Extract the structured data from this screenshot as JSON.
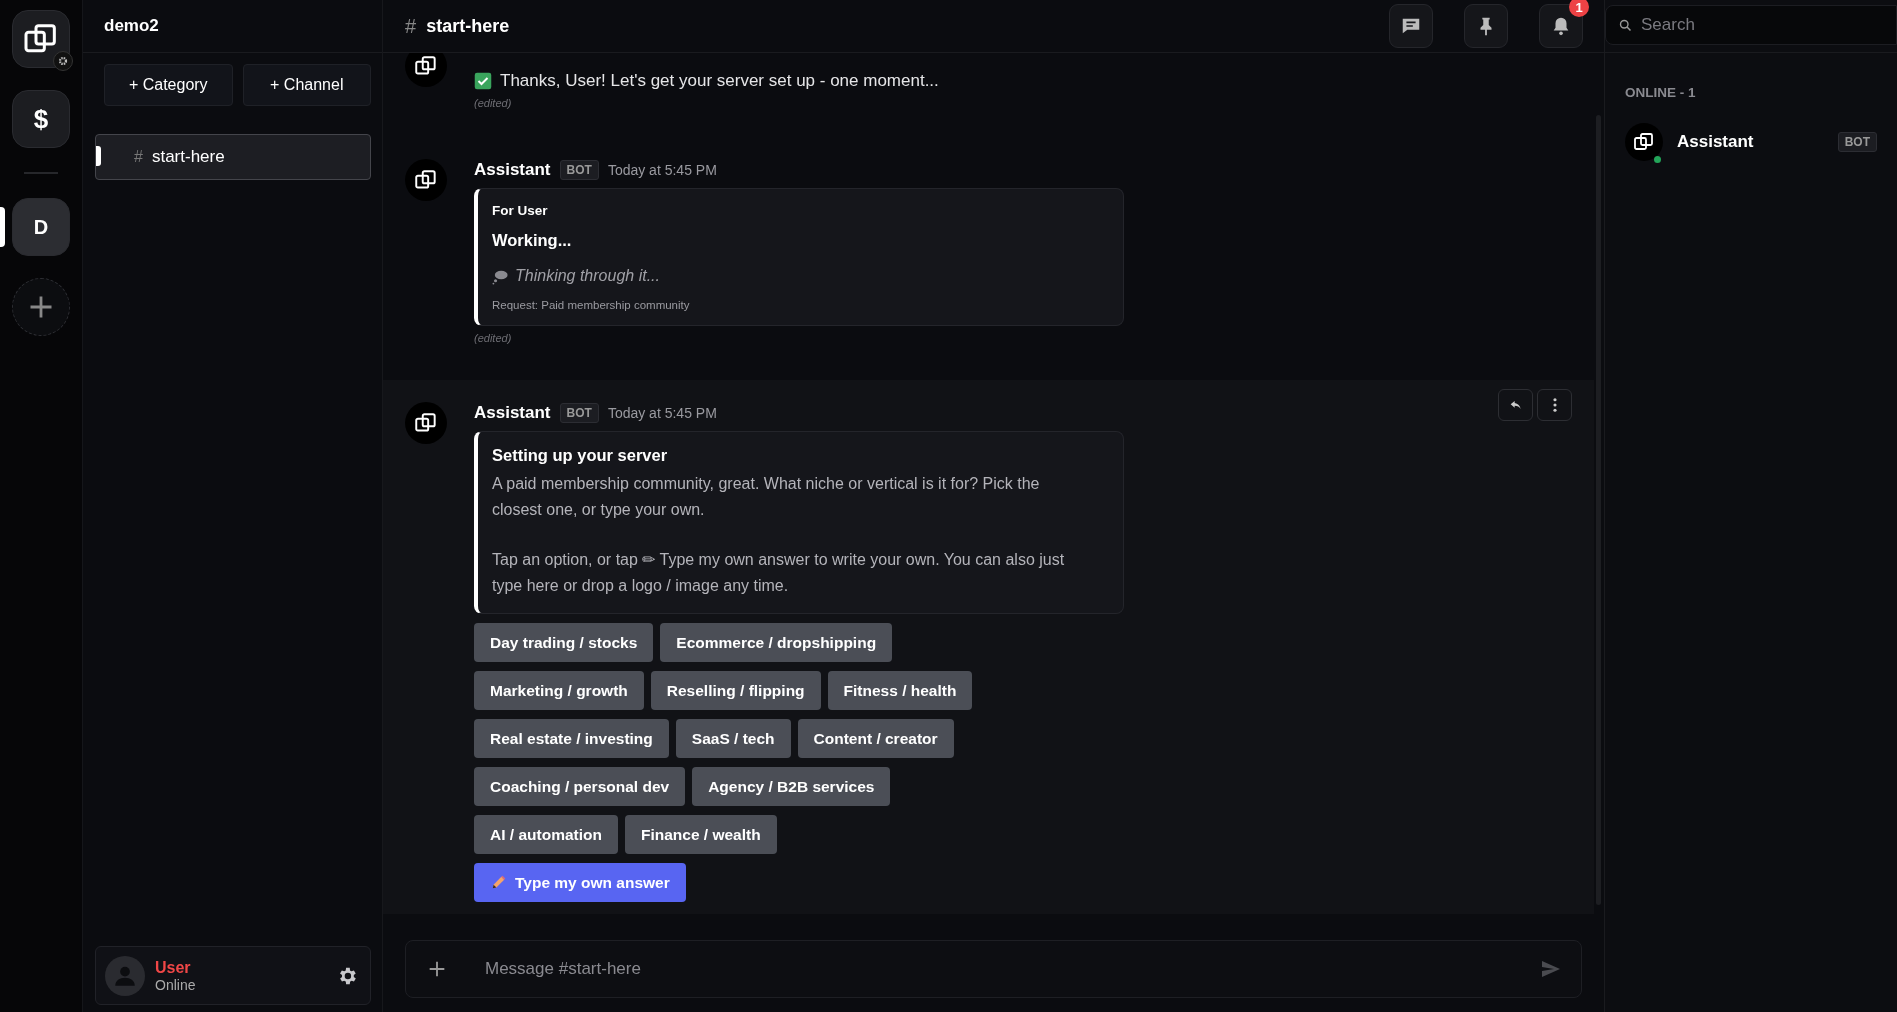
{
  "server_rail": {
    "servers": [
      {
        "kind": "logo",
        "selected": false
      },
      {
        "kind": "glyph",
        "label": "$",
        "selected": false
      },
      {
        "kind": "letter",
        "label": "D",
        "selected": true
      },
      {
        "kind": "add",
        "selected": false
      }
    ]
  },
  "channel_sidebar": {
    "server_name": "demo2",
    "actions": [
      "+ Category",
      "+ Channel"
    ],
    "channels": [
      {
        "hash": "#",
        "name": "start-here",
        "selected": true
      }
    ]
  },
  "user_panel": {
    "name": "User",
    "status": "Online"
  },
  "header": {
    "hash": "#",
    "channel": "start-here",
    "notification_count": "1"
  },
  "search": {
    "placeholder": "Search"
  },
  "messages": [
    {
      "kind": "continued",
      "text": "Thanks, User! Let's get your server set up - one moment...",
      "edited": "(edited)",
      "hovered": false
    },
    {
      "kind": "full",
      "author": "Assistant",
      "badge": "BOT",
      "time": "Today at 5:45 PM",
      "embed": {
        "eyebrow": "For User",
        "title": "Working...",
        "status": "Thinking through it...",
        "footer": "Request: Paid membership community"
      },
      "edited": "(edited)",
      "hovered": false
    },
    {
      "kind": "full",
      "author": "Assistant",
      "badge": "BOT",
      "time": "Today at 5:45 PM",
      "embed": {
        "title": "Setting up your server",
        "paragraphs": [
          "A paid membership community, great. What niche or vertical is it for? Pick the closest one, or type your own.",
          "Tap an option, or tap ✏ Type my own answer to write your own. You can also just type here or drop a logo / image any time."
        ]
      },
      "option_rows": [
        [
          "Day trading / stocks",
          "Ecommerce / dropshipping"
        ],
        [
          "Marketing / growth",
          "Reselling / flipping",
          "Fitness / health"
        ],
        [
          "Real estate / investing",
          "SaaS / tech",
          "Content / creator"
        ],
        [
          "Coaching / personal dev",
          "Agency / B2B services"
        ],
        [
          "AI / automation",
          "Finance / wealth"
        ]
      ],
      "custom_answer": "Type my own answer",
      "hovered": true
    }
  ],
  "composer": {
    "placeholder": "Message #start-here"
  },
  "members": {
    "heading": "ONLINE - 1",
    "items": [
      {
        "name": "Assistant",
        "badge": "BOT",
        "online": true
      }
    ]
  }
}
